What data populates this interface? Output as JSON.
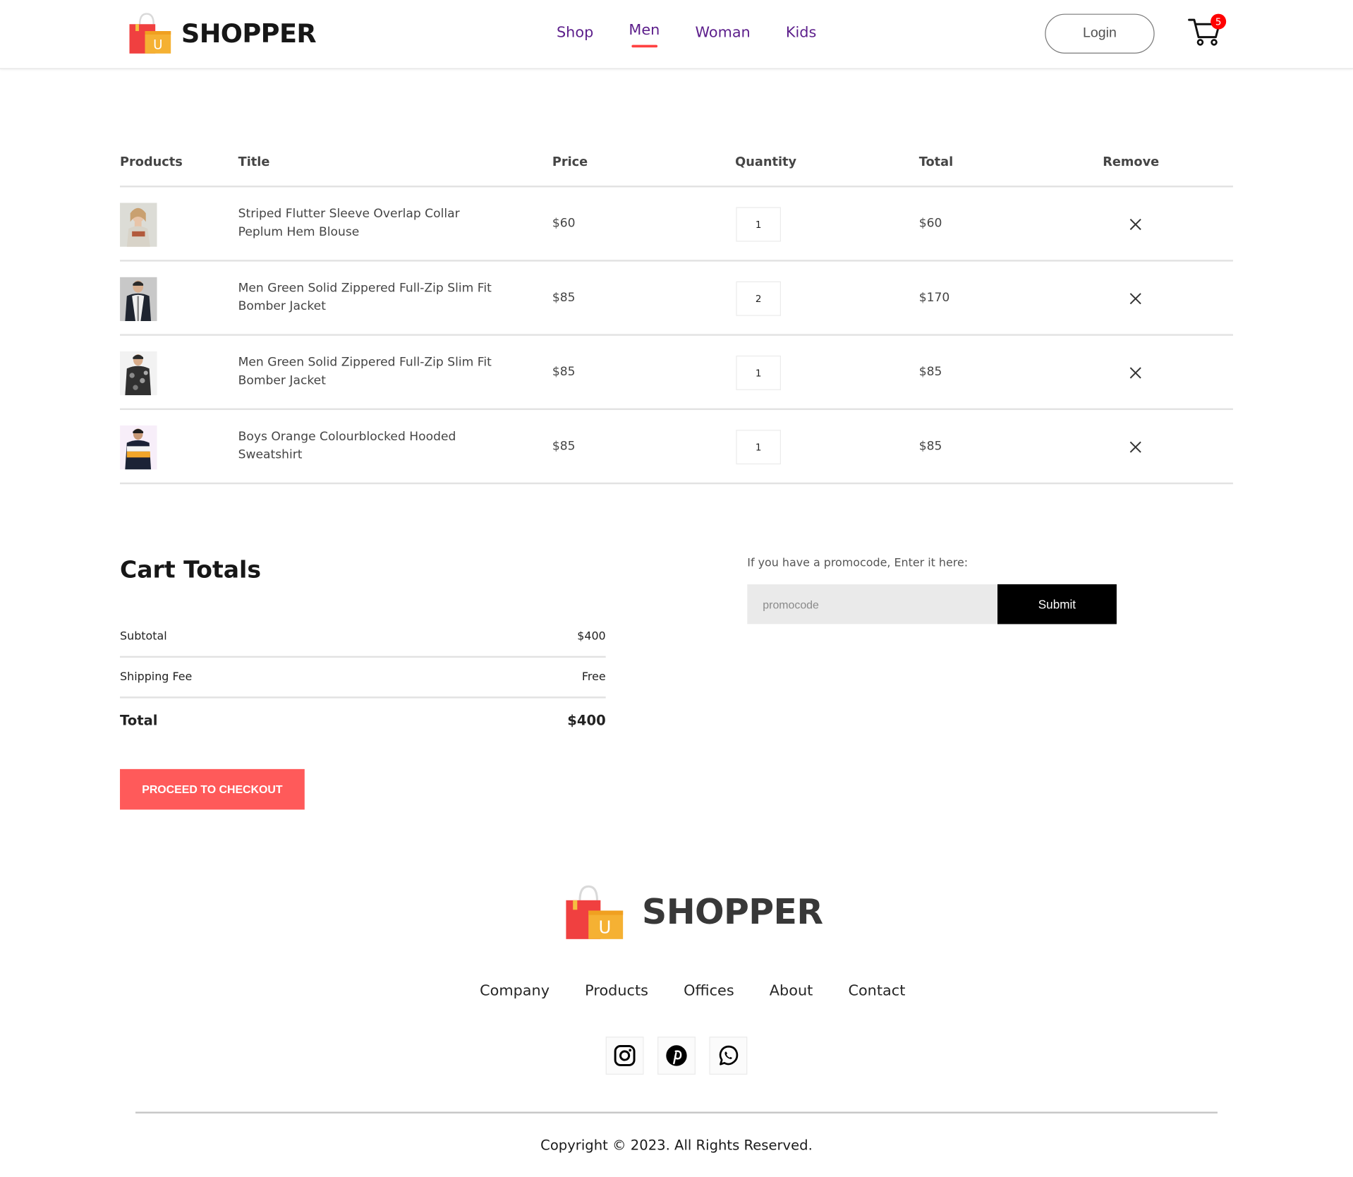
{
  "brand": {
    "name": "SHOPPER",
    "logo_letter": "U"
  },
  "nav": {
    "items": [
      {
        "label": "Shop"
      },
      {
        "label": "Men",
        "active": true
      },
      {
        "label": "Woman"
      },
      {
        "label": "Kids"
      }
    ],
    "login_label": "Login",
    "cart_count": "5"
  },
  "cart_table": {
    "headers": [
      "Products",
      "Title",
      "Price",
      "Quantity",
      "Total",
      "Remove"
    ],
    "rows": [
      {
        "title": "Striped Flutter Sleeve Overlap Collar Peplum Hem Blouse",
        "price": "$60",
        "quantity": "1",
        "total": "$60"
      },
      {
        "title": "Men Green Solid Zippered Full-Zip Slim Fit Bomber Jacket",
        "price": "$85",
        "quantity": "2",
        "total": "$170"
      },
      {
        "title": "Men Green Solid Zippered Full-Zip Slim Fit Bomber Jacket",
        "price": "$85",
        "quantity": "1",
        "total": "$85"
      },
      {
        "title": "Boys Orange Colourblocked Hooded Sweatshirt",
        "price": "$85",
        "quantity": "1",
        "total": "$85"
      }
    ]
  },
  "totals": {
    "title": "Cart Totals",
    "subtotal_label": "Subtotal",
    "subtotal": "$400",
    "shipping_label": "Shipping Fee",
    "shipping": "Free",
    "total_label": "Total",
    "total": "$400",
    "checkout_label": "PROCEED TO CHECKOUT"
  },
  "promo": {
    "label": "If you have a promocode, Enter it here:",
    "placeholder": "promocode",
    "submit_label": "Submit"
  },
  "footer": {
    "brand": "SHOPPER",
    "links": [
      "Company",
      "Products",
      "Offices",
      "About",
      "Contact"
    ],
    "social_icons": [
      "instagram-icon",
      "pinterest-icon",
      "whatsapp-icon"
    ],
    "copyright": "Copyright © 2023. All Rights Reserved."
  },
  "colors": {
    "accent": "#ff4141",
    "nav_link": "#5c1e8b",
    "checkout": "#ff5a5a"
  }
}
